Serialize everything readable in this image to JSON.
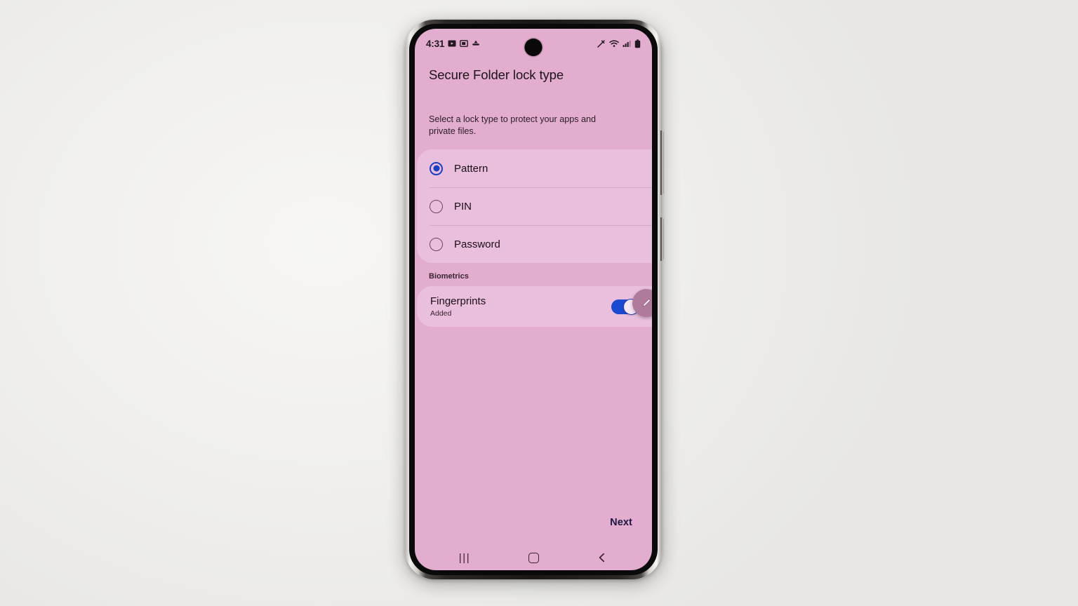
{
  "device": {
    "name": "samsung-galaxy-phone",
    "side_buttons": [
      "volume-rocker",
      "power-button"
    ]
  },
  "status_bar": {
    "clock": "4:31",
    "left_icons": [
      "media-notification-icon",
      "screenshot-notification-icon",
      "download-notification-icon"
    ],
    "right_icons": [
      "mute-icon",
      "wifi-icon",
      "signal-icon",
      "battery-icon"
    ]
  },
  "screen": {
    "title": "Secure Folder lock type",
    "description": "Select a lock type to protect your apps and private files.",
    "lock_types": [
      {
        "label": "Pattern",
        "selected": true
      },
      {
        "label": "PIN",
        "selected": false
      },
      {
        "label": "Password",
        "selected": false
      }
    ],
    "biometrics": {
      "header": "Biometrics",
      "fingerprints": {
        "title": "Fingerprints",
        "status": "Added",
        "toggle_on": true
      }
    },
    "edit_fab": {
      "icon": "pencil-icon"
    },
    "next_label": "Next"
  },
  "nav_bar": {
    "recents_label": "|||",
    "buttons": [
      "recents-button",
      "home-button",
      "back-button"
    ]
  },
  "colors": {
    "screen_background": "#e2adcf",
    "card_background": "#eabfde",
    "accent_blue": "#1b3fbf",
    "toggle_on": "#1b49cf",
    "fab_background": "#b07a9d",
    "text_primary": "#190f15",
    "next_text": "#1c1740"
  }
}
